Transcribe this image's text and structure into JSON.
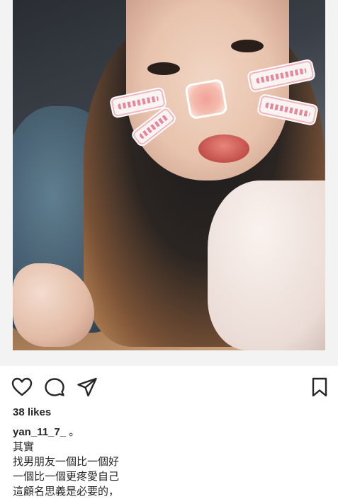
{
  "post": {
    "photo_alt": "selfie with face stickers",
    "likes": "38 likes",
    "username": "yan_11_7_",
    "caption_suffix": " 。",
    "caption_lines": [
      "其實",
      "找男朋友一個比一個好",
      "一個比一個更疼愛自己",
      "這顧名思義是必要的，"
    ]
  },
  "actions": {
    "like_icon": "heart-icon",
    "comment_icon": "comment-icon",
    "share_icon": "share-icon",
    "save_icon": "bookmark-icon"
  },
  "colors": {
    "text": "#262626",
    "background": "#ffffff",
    "sticker_pink": "#e46b88"
  }
}
